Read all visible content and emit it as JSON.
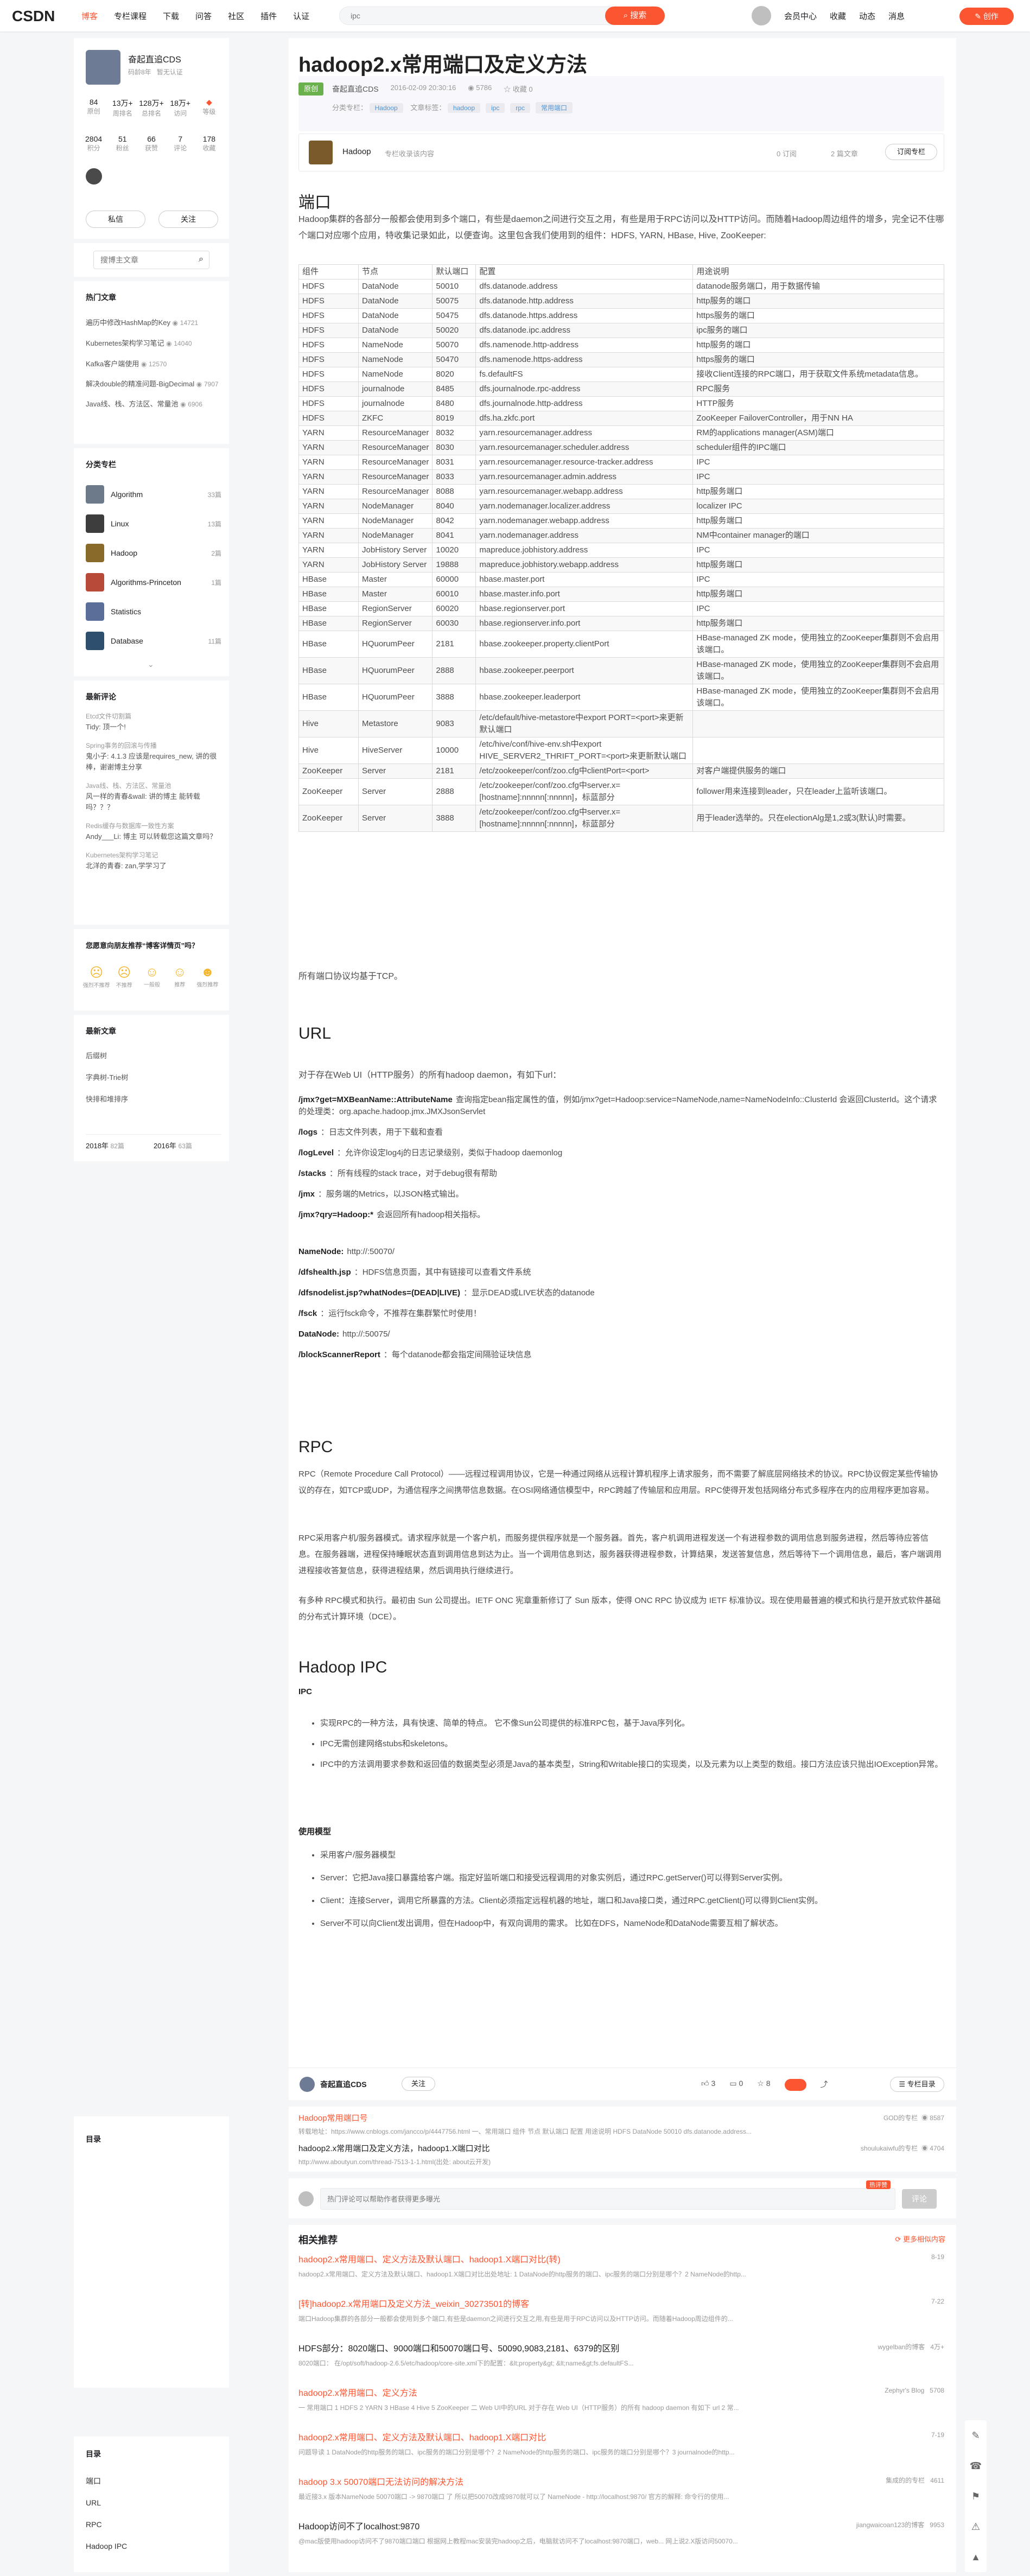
{
  "header": {
    "logo": "CSDN",
    "nav": [
      "博客",
      "专栏课程",
      "下载",
      "问答",
      "社区",
      "插件",
      "认证"
    ],
    "search_placeholder": "ipc",
    "search_btn": "搜索",
    "right": [
      "会员中心",
      "收藏",
      "动态",
      "消息"
    ],
    "create": "创作"
  },
  "author": {
    "name": "奋起直追CDS",
    "sub": "暂无认证",
    "stats1": [
      {
        "v": "84",
        "l": "原创"
      },
      {
        "v": "13万+",
        "l": "周排名"
      },
      {
        "v": "128万+",
        "l": "总排名"
      },
      {
        "v": "18万+",
        "l": "访问"
      },
      {
        "v": "",
        "l": "等级"
      }
    ],
    "stats2": [
      {
        "v": "2804",
        "l": "积分"
      },
      {
        "v": "51",
        "l": "粉丝"
      },
      {
        "v": "66",
        "l": "获赞"
      },
      {
        "v": "7",
        "l": "评论"
      },
      {
        "v": "178",
        "l": "收藏"
      }
    ],
    "msg": "私信",
    "follow": "关注"
  },
  "side_search": "搜博主文章",
  "hot": {
    "title": "热门文章",
    "items": [
      {
        "t": "遍历中修改HashMap的Key",
        "n": "14721"
      },
      {
        "t": "Kubernetes架构学习笔记",
        "n": "14040"
      },
      {
        "t": "Kafka客户端使用",
        "n": "12570"
      },
      {
        "t": "解决double的精准问题-BigDecimal",
        "n": "7907"
      },
      {
        "t": "Java线、栈、方法区、常量池",
        "n": "6906"
      }
    ]
  },
  "cats": {
    "title": "分类专栏",
    "items": [
      {
        "t": "Algorithm",
        "n": "33篇"
      },
      {
        "t": "Linux",
        "n": "13篇"
      },
      {
        "t": "Hadoop",
        "n": "2篇"
      },
      {
        "t": "Algorithms-Princeton",
        "n": "1篇"
      },
      {
        "t": "Statistics",
        "n": ""
      },
      {
        "t": "Database",
        "n": "11篇"
      }
    ]
  },
  "comments": {
    "title": "最新评论",
    "items": [
      {
        "h": "Etcd文件切割篇",
        "b": "Tidy: 顶一个!"
      },
      {
        "h": "Spring事务的回滚与传播",
        "b": "鬼小子: 4.1.3 应该是requires_new, 讲的很棒，谢谢博主分享"
      },
      {
        "h": "Java线、栈、方法区、常量池",
        "b": "风一样的青春&wall: 讲的博主 能转载吗？？？"
      },
      {
        "h": "Redis缓存与数据库一致性方案",
        "b": "Andy___Li: 博主 可以转载您这篇文章吗？"
      },
      {
        "h": "Kubernetes架构学习笔记",
        "b": "北洋的青春: zan,学学习了"
      }
    ]
  },
  "survey": {
    "title": "您愿意向朋友推荐“博客详情页”吗？",
    "opts": [
      "强烈不推荐",
      "不推荐",
      "一般般",
      "推荐",
      "强烈推荐"
    ]
  },
  "latest": {
    "title": "最新文章",
    "items": [
      "后缀树",
      "字典树-Trie树",
      "快排和堆排序"
    ],
    "years": [
      {
        "y": "2018年",
        "n": "82篇"
      },
      {
        "y": "2016年",
        "n": "63篇"
      }
    ]
  },
  "toc1": {
    "title": "目录"
  },
  "toc2": {
    "title": "目录",
    "items": [
      "端口",
      "URL",
      "RPC",
      "Hadoop IPC"
    ]
  },
  "article": {
    "title": "hadoop2.x常用端口及定义方法",
    "type": "原创",
    "author": "奋起直追CDS",
    "date": "2016-02-09 20:30:16",
    "views": "5786",
    "fav": "收藏 0",
    "cat_label": "分类专栏：",
    "cat": "Hadoop",
    "tag_label": "文章标签：",
    "tags": [
      "hadoop",
      "ipc",
      "rpc",
      "常用端口"
    ],
    "col_name": "Hadoop",
    "col_desc": "专栏收录该内容",
    "col_count": "0 订阅",
    "col_articles": "2 篇文章",
    "col_sub": "订阅专栏"
  },
  "ports": {
    "title": "端口",
    "intro": "Hadoop集群的各部分一般都会使用到多个端口，有些是daemon之间进行交互之用，有些是用于RPC访问以及HTTP访问。而随着Hadoop周边组件的增多，完全记不住哪个端口对应哪个应用，特收集记录如此，以便查询。这里包含我们使用到的组件：HDFS, YARN, HBase, Hive, ZooKeeper:",
    "headers": [
      "组件",
      "节点",
      "默认端口",
      "配置",
      "用途说明"
    ],
    "rows": [
      [
        "HDFS",
        "DataNode",
        "50010",
        "dfs.datanode.address",
        "datanode服务端口，用于数据传输"
      ],
      [
        "HDFS",
        "DataNode",
        "50075",
        "dfs.datanode.http.address",
        "http服务的端口"
      ],
      [
        "HDFS",
        "DataNode",
        "50475",
        "dfs.datanode.https.address",
        "https服务的端口"
      ],
      [
        "HDFS",
        "DataNode",
        "50020",
        "dfs.datanode.ipc.address",
        "ipc服务的端口"
      ],
      [
        "HDFS",
        "NameNode",
        "50070",
        "dfs.namenode.http-address",
        "http服务的端口"
      ],
      [
        "HDFS",
        "NameNode",
        "50470",
        "dfs.namenode.https-address",
        "https服务的端口"
      ],
      [
        "HDFS",
        "NameNode",
        "8020",
        "fs.defaultFS",
        "接收Client连接的RPC端口，用于获取文件系统metadata信息。"
      ],
      [
        "HDFS",
        "journalnode",
        "8485",
        "dfs.journalnode.rpc-address",
        "RPC服务"
      ],
      [
        "HDFS",
        "journalnode",
        "8480",
        "dfs.journalnode.http-address",
        "HTTP服务"
      ],
      [
        "HDFS",
        "ZKFC",
        "8019",
        "dfs.ha.zkfc.port",
        "ZooKeeper FailoverController，用于NN HA"
      ],
      [
        "YARN",
        "ResourceManager",
        "8032",
        "yarn.resourcemanager.address",
        "RM的applications manager(ASM)端口"
      ],
      [
        "YARN",
        "ResourceManager",
        "8030",
        "yarn.resourcemanager.scheduler.address",
        "scheduler组件的IPC端口"
      ],
      [
        "YARN",
        "ResourceManager",
        "8031",
        "yarn.resourcemanager.resource-tracker.address",
        "IPC"
      ],
      [
        "YARN",
        "ResourceManager",
        "8033",
        "yarn.resourcemanager.admin.address",
        "IPC"
      ],
      [
        "YARN",
        "ResourceManager",
        "8088",
        "yarn.resourcemanager.webapp.address",
        "http服务端口"
      ],
      [
        "YARN",
        "NodeManager",
        "8040",
        "yarn.nodemanager.localizer.address",
        "localizer IPC"
      ],
      [
        "YARN",
        "NodeManager",
        "8042",
        "yarn.nodemanager.webapp.address",
        "http服务端口"
      ],
      [
        "YARN",
        "NodeManager",
        "8041",
        "yarn.nodemanager.address",
        "NM中container manager的端口"
      ],
      [
        "YARN",
        "JobHistory Server",
        "10020",
        "mapreduce.jobhistory.address",
        "IPC"
      ],
      [
        "YARN",
        "JobHistory Server",
        "19888",
        "mapreduce.jobhistory.webapp.address",
        "http服务端口"
      ],
      [
        "HBase",
        "Master",
        "60000",
        "hbase.master.port",
        "IPC"
      ],
      [
        "HBase",
        "Master",
        "60010",
        "hbase.master.info.port",
        "http服务端口"
      ],
      [
        "HBase",
        "RegionServer",
        "60020",
        "hbase.regionserver.port",
        "IPC"
      ],
      [
        "HBase",
        "RegionServer",
        "60030",
        "hbase.regionserver.info.port",
        "http服务端口"
      ],
      [
        "HBase",
        "HQuorumPeer",
        "2181",
        "hbase.zookeeper.property.clientPort",
        "HBase-managed ZK mode，使用独立的ZooKeeper集群则不会启用该端口。"
      ],
      [
        "HBase",
        "HQuorumPeer",
        "2888",
        "hbase.zookeeper.peerport",
        "HBase-managed ZK mode，使用独立的ZooKeeper集群则不会启用该端口。"
      ],
      [
        "HBase",
        "HQuorumPeer",
        "3888",
        "hbase.zookeeper.leaderport",
        "HBase-managed ZK mode，使用独立的ZooKeeper集群则不会启用该端口。"
      ],
      [
        "Hive",
        "Metastore",
        "9083",
        "/etc/default/hive-metastore中export PORT=<port>来更新默认端口",
        ""
      ],
      [
        "Hive",
        "HiveServer",
        "10000",
        "/etc/hive/conf/hive-env.sh中export HIVE_SERVER2_THRIFT_PORT=<port>来更新默认端口",
        ""
      ],
      [
        "ZooKeeper",
        "Server",
        "2181",
        "/etc/zookeeper/conf/zoo.cfg中clientPort=<port>",
        "对客户端提供服务的端口"
      ],
      [
        "ZooKeeper",
        "Server",
        "2888",
        "/etc/zookeeper/conf/zoo.cfg中server.x=[hostname]:nnnnn[:nnnnn]，标蓝部分",
        "follower用来连接到leader，只在leader上监听该端口。"
      ],
      [
        "ZooKeeper",
        "Server",
        "3888",
        "/etc/zookeeper/conf/zoo.cfg中server.x=[hostname]:nnnnn[:nnnnn]，标蓝部分",
        "用于leader选举的。只在electionAlg是1,2或3(默认)时需要。"
      ]
    ],
    "note": "所有端口协议均基于TCP。"
  },
  "url": {
    "title": "URL",
    "intro": "对于存在Web UI（HTTP服务）的所有hadoop daemon，有如下url：",
    "items": [
      {
        "k": "/jmx?get=MXBeanName::AttributeName",
        "v": "查询指定bean指定属性的值，例如/jmx?get=Hadoop:service=NameNode,name=NameNodeInfo::ClusterId 会返回ClusterId。这个请求的处理类：org.apache.hadoop.jmx.JMXJsonServlet"
      },
      {
        "k": "/logs",
        "v": "：日志文件列表，用于下载和查看"
      },
      {
        "k": "/logLevel",
        "v": "：允许你设定log4j的日志记录级别，类似于hadoop daemonlog"
      },
      {
        "k": "/stacks",
        "v": "：所有线程的stack trace，对于debug很有帮助"
      },
      {
        "k": "/jmx",
        "v": "：服务端的Metrics，以JSON格式输出。"
      },
      {
        "k": "/jmx?qry=Hadoop:*",
        "v": "会返回所有hadoop相关指标。"
      },
      {
        "k": "NameNode:",
        "v": "http://:50070/"
      },
      {
        "k": "/dfshealth.jsp",
        "v": "：HDFS信息页面，其中有链接可以查看文件系统"
      },
      {
        "k": "/dfsnodelist.jsp?whatNodes=(DEAD|LIVE)",
        "v": "：显示DEAD或LIVE状态的datanode"
      },
      {
        "k": "/fsck",
        "v": "：运行fsck命令，不推荐在集群繁忙时使用！"
      },
      {
        "k": "DataNode:",
        "v": "http://:50075/"
      },
      {
        "k": "/blockScannerReport",
        "v": "：每个datanode都会指定间隔验证块信息"
      }
    ]
  },
  "rpc": {
    "title": "RPC",
    "p1": "RPC（Remote Procedure Call Protocol）——远程过程调用协议，它是一种通过网络从远程计算机程序上请求服务，而不需要了解底层网络技术的协议。RPC协议假定某些传输协议的存在，如TCP或UDP，为通信程序之间携带信息数据。在OSI网络通信模型中，RPC跨越了传输层和应用层。RPC使得开发包括网络分布式多程序在内的应用程序更加容易。",
    "p2": "RPC采用客户机/服务器模式。请求程序就是一个客户机，而服务提供程序就是一个服务器。首先，客户机调用进程发送一个有进程参数的调用信息到服务进程，然后等待应答信息。在服务器端，进程保持睡眠状态直到调用信息到达为止。当一个调用信息到达，服务器获得进程参数，计算结果，发送答复信息，然后等待下一个调用信息，最后，客户端调用进程接收答复信息，获得进程结果，然后调用执行继续进行。",
    "p3": "有多种 RPC模式和执行。最初由 Sun 公司提出。IETF ONC 宪章重新修订了 Sun 版本，使得 ONC RPC 协议成为 IETF 标准协议。现在使用最普遍的模式和执行是开放式软件基础的分布式计算环境（DCE）。"
  },
  "ipc": {
    "title": "Hadoop IPC",
    "sub": "IPC",
    "items": [
      "实现RPC的一种方法，具有快速、简单的特点。 它不像Sun公司提供的标准RPC包，基于Java序列化。",
      "IPC无需创建网络stubs和skeletons。",
      "IPC中的方法调用要求参数和返回值的数据类型必须是Java的基本类型，String和Writable接口的实现类，以及元素为以上类型的数组。接口方法应该只抛出IOException异常。"
    ],
    "model_title": "使用模型",
    "model": [
      "采用客户/服务器模型",
      "Server：它把Java接口暴露给客户端。指定好监听端口和接受远程调用的对象实例后，通过RPC.getServer()可以得到Server实例。",
      "Client：连接Server，调用它所暴露的方法。Client必须指定远程机器的地址，端口和Java接口类，通过RPC.getClient()可以得到Client实例。",
      "Server不可以向Client发出调用，但在Hadoop中，有双向调用的需求。 比如在DFS，NameNode和DataNode需要互相了解状态。"
    ]
  },
  "actions": {
    "author": "奋起直追CDS",
    "follow": "关注",
    "like": "3",
    "dislike": "0",
    "fav": "8",
    "catalog": "专栏目录"
  },
  "related_top": [
    {
      "t": "Hadoop常用端口号",
      "src": "GOD的专栏",
      "n": "8587",
      "d": "转载地址：https://www.cnblogs.com/jancco/p/4447756.html 一、常用端口 组件 节点 默认端口 配置 用途说明 HDFS DataNode 50010 dfs.datanode.address..."
    },
    {
      "t": "hadoop2.x常用端口及定义方法，hadoop1.X端口对比",
      "src": "shoulukaiwfu的专栏",
      "n": "4704",
      "d": "http://www.aboutyun.com/thread-7513-1-1.html(出处: about云开发)"
    }
  ],
  "comment_box": {
    "placeholder": "热门评论可以帮助作者获得更多曝光",
    "badge": "热评赞",
    "btn": "评论"
  },
  "reco": {
    "title": "相关推荐",
    "more": "更多相似内容",
    "items": [
      {
        "t": "hadoop2.x常用端口、定义方法及默认端口、hadoop1.X端口对比(转)",
        "date": "8-19",
        "d": "hadoop2.x常用端口、定义方法及默认端口、hadoop1.X端口对比出处地址: 1 DataNode的http服务的端口、ipc服务的端口分别是哪个？2 NameNode的http..."
      },
      {
        "t": "[转]hadoop2.x常用端口及定义方法_weixin_30273501的博客",
        "date": "7-22",
        "d": "端口Hadoop集群的各部分一般都会使用到多个端口,有些是daemon之间进行交互之用,有些是用于RPC访问以及HTTP访问。而随着Hadoop周边组件的..."
      },
      {
        "t": "HDFS部分：8020端口、9000端口和50070端口号、50090,9083,2181、6379的区别",
        "src": "wygelban的博客",
        "n": "4万+",
        "date": "",
        "d": "8020端口： 在/opt/soft/hadoop-2.6.5/etc/hadoop/core-site.xml下的配置：&lt;property&gt; &lt;name&gt;fs.defaultFS..."
      },
      {
        "t": "hadoop2.x常用端口、定义方法",
        "src": "Zephyr's Blog",
        "n": "5708",
        "date": "",
        "d": "一 常用端口 1 HDFS 2 YARN 3 HBase 4 Hive 5 ZooKeeper 二 Web UI中的URL 对于存在 Web UI（HTTP服务）的所有 hadoop daemon 有如下 url 2 常..."
      },
      {
        "t": "hadoop2.x常用端口、定义方法及默认端口、hadoop1.X端口对比",
        "date": "7-19",
        "d": "问题导读 1 DataNode的http服务的端口、ipc服务的端口分别是哪个？2 NameNode的http服务的端口、ipc服务的端口分别是哪个？3 journalnode的http..."
      },
      {
        "t": "hadoop 3.x 50070端口无法访问的解决方法",
        "src": "集成的的专栏",
        "n": "4611",
        "date": "",
        "d": "最近接3.x 版本NameNode 50070端口 -> 9870端口 了 所以把50070改成9870就可以了 NameNode - http://localhost:9870/ 官方的解释: 命令行的使用..."
      },
      {
        "t": "Hadoop访问不了localhost:9870",
        "src": "jiangwaicoan123的博客",
        "n": "9953",
        "date": "",
        "d": "@mac版使用hadoop访问不了9870端口端口 根据网上教程mac安装完hadoop之后，电脑就访问不了localhost:9870端口，web... 网上说2.X版访问50070..."
      }
    ]
  }
}
